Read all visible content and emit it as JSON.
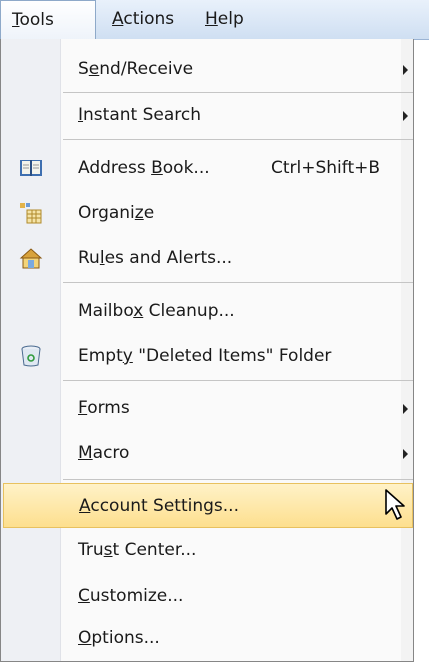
{
  "menubar": [
    {
      "pre": "",
      "acc": "T",
      "post": "ools"
    },
    {
      "pre": "",
      "acc": "A",
      "post": "ctions"
    },
    {
      "pre": "",
      "acc": "H",
      "post": "elp"
    }
  ],
  "items": [
    {
      "pre": "S",
      "acc": "e",
      "post": "nd/Receive",
      "icon": "",
      "submenu": true
    },
    {
      "pre": "",
      "acc": "I",
      "post": "nstant Search",
      "icon": "",
      "submenu": true
    },
    {
      "pre": "Address ",
      "acc": "B",
      "post": "ook...",
      "shortcut": "Ctrl+Shift+B",
      "icon": "address-book-icon"
    },
    {
      "pre": "Organi",
      "acc": "z",
      "post": "e",
      "icon": "organize-icon"
    },
    {
      "pre": "Ru",
      "acc": "l",
      "post": "es and Alerts...",
      "icon": "rules-alerts-icon"
    },
    {
      "pre": "Mailbo",
      "acc": "x",
      "post": " Cleanup...",
      "icon": ""
    },
    {
      "pre": "Empt",
      "acc": "y",
      "post": " \"Deleted Items\" Folder",
      "icon": "recycle-bin-icon"
    },
    {
      "pre": "",
      "acc": "F",
      "post": "orms",
      "icon": "",
      "submenu": true
    },
    {
      "pre": "",
      "acc": "M",
      "post": "acro",
      "icon": "",
      "submenu": true
    },
    {
      "pre": "",
      "acc": "A",
      "post": "ccount Settings...",
      "icon": "",
      "highlighted": true
    },
    {
      "pre": "Tru",
      "acc": "s",
      "post": "t Center...",
      "icon": ""
    },
    {
      "pre": "",
      "acc": "C",
      "post": "ustomize...",
      "icon": ""
    },
    {
      "pre": "",
      "acc": "O",
      "post": "ptions...",
      "icon": ""
    }
  ],
  "colors": {
    "highlight": "#fddf8e",
    "gutter": "#eef0f4",
    "menubar": "#cfdff2"
  }
}
